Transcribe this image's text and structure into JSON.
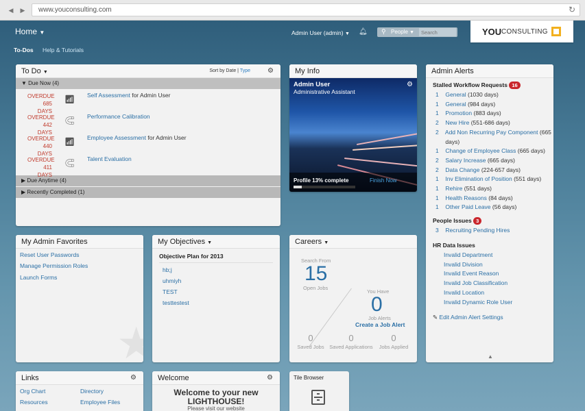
{
  "browser": {
    "url": "www.youconsulting.com",
    "back_icon": "◀",
    "forward_icon": "▶",
    "reload_icon": "↻"
  },
  "header": {
    "home_label": "Home",
    "nav": [
      "To-Dos",
      "Help & Tutorials"
    ],
    "user_label": "Admin User (admin)",
    "search_scope": "People",
    "search_placeholder": "Search",
    "logo_you": "YOU",
    "logo_consulting": "CONSULTING"
  },
  "todo": {
    "title": "To Do",
    "sort_prefix": "Sort by Date |",
    "sort_link": "Type",
    "due_now_label": "Due Now (4)",
    "due_anytime_label": "Due Anytime (4)",
    "recently_completed_label": "Recently Completed (1)",
    "items": [
      {
        "status": "OVERDUE",
        "days": "685 DAYS",
        "link": "Self Assessment",
        "suffix": "for Admin User"
      },
      {
        "status": "OVERDUE",
        "days": "442 DAYS",
        "link": "Performance Calibration",
        "suffix": ""
      },
      {
        "status": "OVERDUE",
        "days": "440 DAYS",
        "link": "Employee Assessment",
        "suffix": "for Admin User"
      },
      {
        "status": "OVERDUE",
        "days": "411 DAYS",
        "link": "Talent Evaluation",
        "suffix": ""
      }
    ]
  },
  "myinfo": {
    "title": "My Info",
    "name": "Admin User",
    "job_title": "Administrative Assistant",
    "profile_label": "Profile 13% complete",
    "profile_complete": 0.13,
    "finish_label": "Finish Now"
  },
  "alerts": {
    "title": "Admin Alerts",
    "stalled_label": "Stalled Workflow Requests",
    "stalled_count": "16",
    "stalled": [
      {
        "n": "1",
        "name": "General",
        "rest": "(1030 days)"
      },
      {
        "n": "1",
        "name": "General",
        "rest": "(984 days)"
      },
      {
        "n": "1",
        "name": "Promotion",
        "rest": "(883 days)"
      },
      {
        "n": "2",
        "name": "New Hire",
        "rest": "(551-686 days)"
      },
      {
        "n": "2",
        "name": "Add Non Recurring Pay Component",
        "rest": "(665"
      },
      {
        "n": "",
        "name": "",
        "rest": "days)"
      },
      {
        "n": "1",
        "name": "Change of Employee Class",
        "rest": "(665 days)"
      },
      {
        "n": "2",
        "name": "Salary Increase",
        "rest": "(665 days)"
      },
      {
        "n": "2",
        "name": "Data Change",
        "rest": "(224-657 days)"
      },
      {
        "n": "1",
        "name": "Inv Elimination of Position",
        "rest": "(551 days)"
      },
      {
        "n": "1",
        "name": "Rehire",
        "rest": "(551 days)"
      },
      {
        "n": "1",
        "name": "Health Reasons",
        "rest": "(84 days)"
      },
      {
        "n": "1",
        "name": "Other Paid Leave",
        "rest": "(56 days)"
      }
    ],
    "people_label": "People Issues",
    "people_count": "3",
    "people": [
      {
        "n": "3",
        "name": "Recruiting Pending Hires"
      }
    ],
    "hr_label": "HR Data Issues",
    "hr": [
      "Invalid Department",
      "Invalid Division",
      "Invalid Event Reason",
      "Invalid Job Classification",
      "Invalid Location",
      "Invalid Dynamic Role User"
    ],
    "edit_label": "Edit Admin Alert Settings"
  },
  "favorites": {
    "title": "My Admin Favorites",
    "items": [
      "Reset User Passwords",
      "Manage Permission Roles",
      "Launch Forms"
    ]
  },
  "objectives": {
    "title": "My Objectives",
    "plan": "Objective Plan for 2013",
    "items": [
      "hb;j",
      "uhmiyh",
      "TEST",
      "testtestest"
    ]
  },
  "careers": {
    "title": "Careers",
    "search_from": "Search From",
    "open_jobs_count": "15",
    "open_jobs_label": "Open Jobs",
    "you_have": "You Have",
    "alerts_count": "0",
    "alerts_label": "Job Alerts",
    "create_alert": "Create a Job Alert",
    "stats": [
      {
        "num": "0",
        "label": "Saved Jobs"
      },
      {
        "num": "0",
        "label": "Saved Applications"
      },
      {
        "num": "0",
        "label": "Jobs Applied"
      }
    ]
  },
  "links": {
    "title": "Links",
    "items": [
      "Org Chart",
      "Directory",
      "Resources",
      "Employee Files"
    ]
  },
  "welcome": {
    "title": "Welcome",
    "line1": "Welcome to your new",
    "line2": "LIGHTHOUSE!",
    "line3": "Please visit our website"
  },
  "tilebrowser": {
    "title": "Tile Browser"
  }
}
